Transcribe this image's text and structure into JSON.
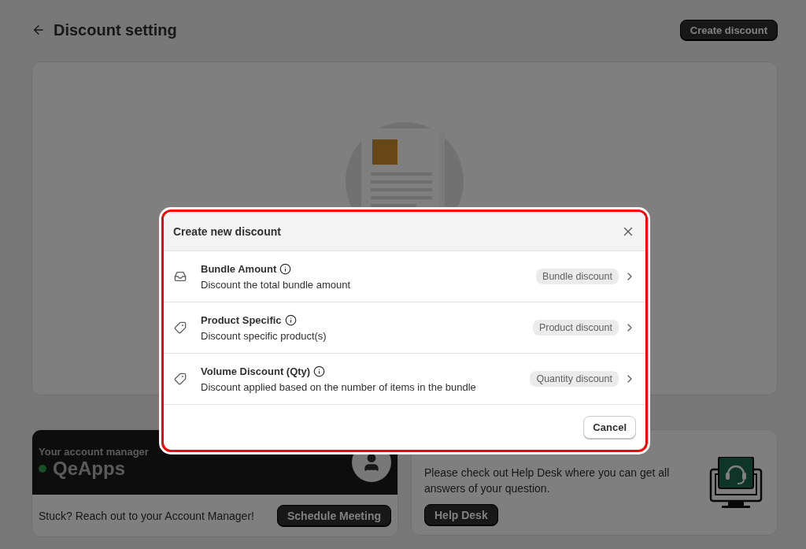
{
  "page": {
    "title": "Discount setting",
    "primary_action": "Create discount"
  },
  "account_manager": {
    "label": "Your account manager",
    "name": "QeApps",
    "online": true,
    "message": "Stuck? Reach out to your Account Manager!",
    "button": "Schedule Meeting"
  },
  "help_desk": {
    "text": "Please check out Help Desk where you can get all answers of your question.",
    "button": "Help Desk"
  },
  "modal": {
    "title": "Create new discount",
    "options": [
      {
        "kind": "inbox",
        "title": "Bundle Amount",
        "description": "Discount the total bundle amount",
        "badge": "Bundle discount"
      },
      {
        "kind": "tag",
        "title": "Product Specific",
        "description": "Discount specific product(s)",
        "badge": "Product discount"
      },
      {
        "kind": "tag",
        "title": "Volume Discount (Qty)",
        "description": "Discount applied based on the number of items in the bundle",
        "badge": "Quantity discount"
      }
    ],
    "cancel": "Cancel"
  }
}
